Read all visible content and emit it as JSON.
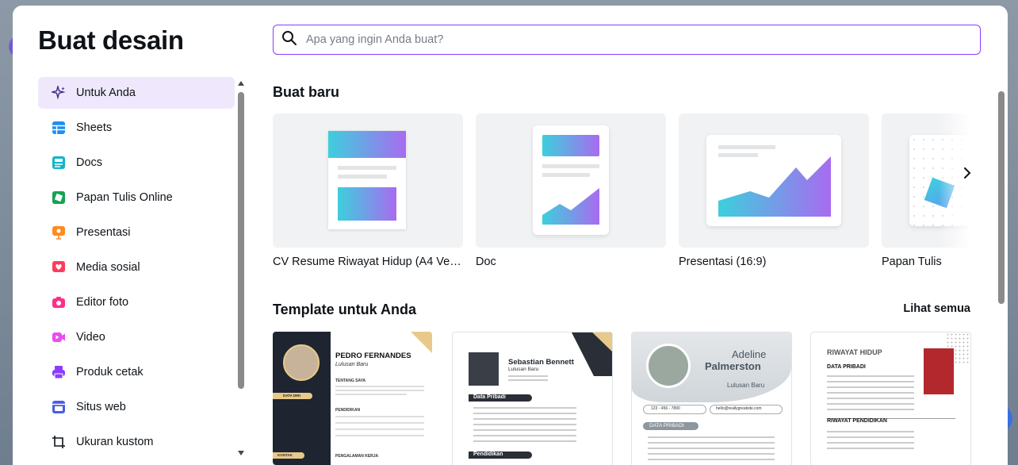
{
  "modal": {
    "title": "Buat desain"
  },
  "search": {
    "placeholder": "Apa yang ingin Anda buat?"
  },
  "sidebar": {
    "items": [
      {
        "label": "Untuk Anda",
        "icon": "sparkle-icon",
        "color": "#4a2db3",
        "active": true
      },
      {
        "label": "Sheets",
        "icon": "sheets-icon",
        "color": "#1f8ef0"
      },
      {
        "label": "Docs",
        "icon": "docs-icon",
        "color": "#13b5c8"
      },
      {
        "label": "Papan Tulis Online",
        "icon": "whiteboard-icon",
        "color": "#14a352"
      },
      {
        "label": "Presentasi",
        "icon": "presentation-icon",
        "color": "#ff8a1f"
      },
      {
        "label": "Media sosial",
        "icon": "heart-icon",
        "color": "#ff3b5c"
      },
      {
        "label": "Editor foto",
        "icon": "camera-icon",
        "color": "#ff2d8a"
      },
      {
        "label": "Video",
        "icon": "video-icon",
        "color": "#e84ef0"
      },
      {
        "label": "Produk cetak",
        "icon": "printer-icon",
        "color": "#8b3dff"
      },
      {
        "label": "Situs web",
        "icon": "website-icon",
        "color": "#4a5ce8"
      },
      {
        "label": "Ukuran kustom",
        "icon": "crop-icon",
        "color": "#0e1318"
      }
    ]
  },
  "create_new": {
    "title": "Buat baru",
    "cards": [
      {
        "label": "CV Resume Riwayat Hidup (A4 Vertikal)"
      },
      {
        "label": "Doc"
      },
      {
        "label": "Presentasi (16:9)"
      },
      {
        "label": "Papan Tulis"
      }
    ]
  },
  "templates": {
    "title": "Template untuk Anda",
    "see_all": "Lihat semua",
    "items": [
      {
        "name": "PEDRO FERNANDES",
        "subtitle": "Lulusan Baru",
        "section1": "DATA DIRI",
        "section2": "TENTANG SAYA",
        "section3": "PENDIDIKAN",
        "section4": "PENGALAMAN KERJA",
        "section5": "KONTAK"
      },
      {
        "name": "Sebastian Bennett",
        "subtitle": "Lulusan Baru",
        "section1": "Data Pribadi",
        "section2": "Pendidikan"
      },
      {
        "name_first": "Adeline",
        "name_last": "Palmerston",
        "subtitle": "Lulusan Baru",
        "section1": "DATA PRIBADI",
        "phone": "123 - 456 - 7890",
        "email": "hello@reallygreatsite.com"
      },
      {
        "name": "RIWAYAT HIDUP",
        "section1": "DATA PRIBADI",
        "section2": "RIWAYAT PENDIDIKAN"
      }
    ]
  },
  "colors": {
    "accent": "#8b3dff",
    "active_bg": "#efe8fd"
  }
}
